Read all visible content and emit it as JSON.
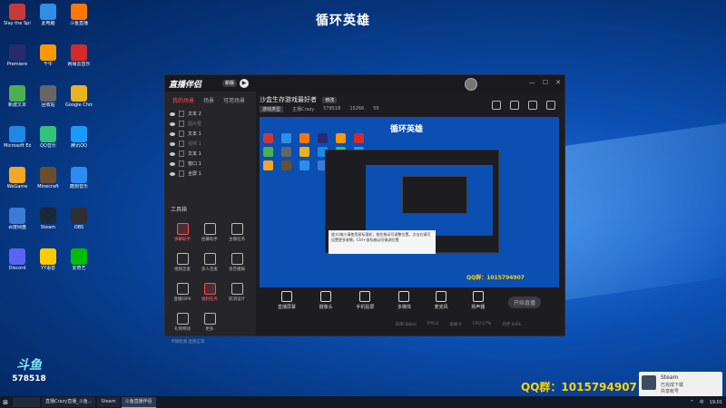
{
  "overlay": {
    "stream_title": "循环英雄",
    "qq_group": "QQ群：1015794907",
    "logo_mark": "斗鱼",
    "logo_sub": "斗鱼",
    "room_number": "578518"
  },
  "desktop_icons": [
    {
      "label": "Slay the Spire",
      "color": "#c83a3a"
    },
    {
      "label": "此电脑",
      "color": "#2f8ee5"
    },
    {
      "label": "斗鱼直播",
      "color": "#ff7700"
    },
    {
      "label": "Premiere",
      "color": "#2a2a6e"
    },
    {
      "label": "千牛",
      "color": "#ff9800"
    },
    {
      "label": "网易云音乐",
      "color": "#d62a2a"
    },
    {
      "label": "新建文本",
      "color": "#4caf50"
    },
    {
      "label": "回收站",
      "color": "#666"
    },
    {
      "label": "Google Chrome",
      "color": "#e9b21f"
    },
    {
      "label": "Microsoft Edge",
      "color": "#1e88e5"
    },
    {
      "label": "QQ音乐",
      "color": "#31c27c"
    },
    {
      "label": "腾讯QQ",
      "color": "#1a9bfc"
    },
    {
      "label": "WeGame",
      "color": "#f5a623"
    },
    {
      "label": "Minecraft",
      "color": "#6b4f2a"
    },
    {
      "label": "酷狗音乐",
      "color": "#2d8cf0"
    },
    {
      "label": "百度网盘",
      "color": "#3a7bd5"
    },
    {
      "label": "Steam",
      "color": "#1b2838"
    },
    {
      "label": "OBS",
      "color": "#302e31"
    },
    {
      "label": "Discord",
      "color": "#5865f2"
    },
    {
      "label": "YY语音",
      "color": "#ffcc00"
    },
    {
      "label": "爱奇艺",
      "color": "#00be06"
    }
  ],
  "app": {
    "logo": "直播伴侣",
    "badge": "新版",
    "play_icon": "▶",
    "window_controls": [
      "—",
      "☐",
      "✕"
    ],
    "left_tabs": [
      "我的场景",
      "场景",
      "可用场景"
    ],
    "scenes": [
      {
        "name": "文本 2",
        "dim": false
      },
      {
        "name": "图片框",
        "dim": true
      },
      {
        "name": "文本 1",
        "dim": false
      },
      {
        "name": "视频 1",
        "dim": true
      },
      {
        "name": "文本 1",
        "dim": false
      },
      {
        "name": "窗口 1",
        "dim": false
      },
      {
        "name": "全屏 1",
        "dim": false
      }
    ],
    "tools_label": "工具箱",
    "tools": [
      {
        "label": "弹幕助手",
        "red": true
      },
      {
        "label": "招募助手",
        "red": false
      },
      {
        "label": "主播任务",
        "red": false
      },
      {
        "label": "视频连麦",
        "red": false
      },
      {
        "label": "多人连麦",
        "red": false
      },
      {
        "label": "语音播报",
        "red": false
      },
      {
        "label": "直播间PK",
        "red": false
      },
      {
        "label": "福利任务",
        "red": true
      },
      {
        "label": "取消设计",
        "red": false
      },
      {
        "label": "礼物特效",
        "red": false
      },
      {
        "label": "更多",
        "red": false
      }
    ],
    "stream_title": "沙盒生存游戏最好者",
    "stream_tag": "修改",
    "stats": {
      "category_btn": "游戏类型",
      "streamer": "主播Crazy",
      "room": "578518",
      "fans": "15266",
      "online": "59"
    },
    "preview": {
      "title": "循环英雄",
      "tooltip": "放大/缩小请使用鼠标滚轮，按住拖动可调整位置。点击右键可设置更多参数。Ctrl+鼠标拖动可微调位置",
      "qq": "QQ群：1015794907"
    },
    "controls": [
      {
        "label": "直播屏幕"
      },
      {
        "label": "摄像头"
      },
      {
        "label": "手机投屏"
      },
      {
        "label": "多媒体"
      },
      {
        "label": "麦克风"
      },
      {
        "label": "扬声器"
      }
    ],
    "go_live": "开始直播",
    "status": [
      "码率:0kb/s",
      "FPS:0",
      "丢帧:0",
      "CPU:17%",
      "内存:43%"
    ],
    "left_status": "卡顿检测 连接正常"
  },
  "notification": {
    "title": "Steam",
    "line1": "已完成下载",
    "line2": "共享帐号"
  },
  "taskbar": {
    "start": "⊞",
    "tasks": [
      {
        "label": "直播Crazy直播_斗鱼...",
        "active": false
      },
      {
        "label": "Steam",
        "active": false
      },
      {
        "label": "斗鱼直播伴侣",
        "active": true
      }
    ],
    "tray": [
      "^",
      "中",
      "19:01"
    ]
  }
}
